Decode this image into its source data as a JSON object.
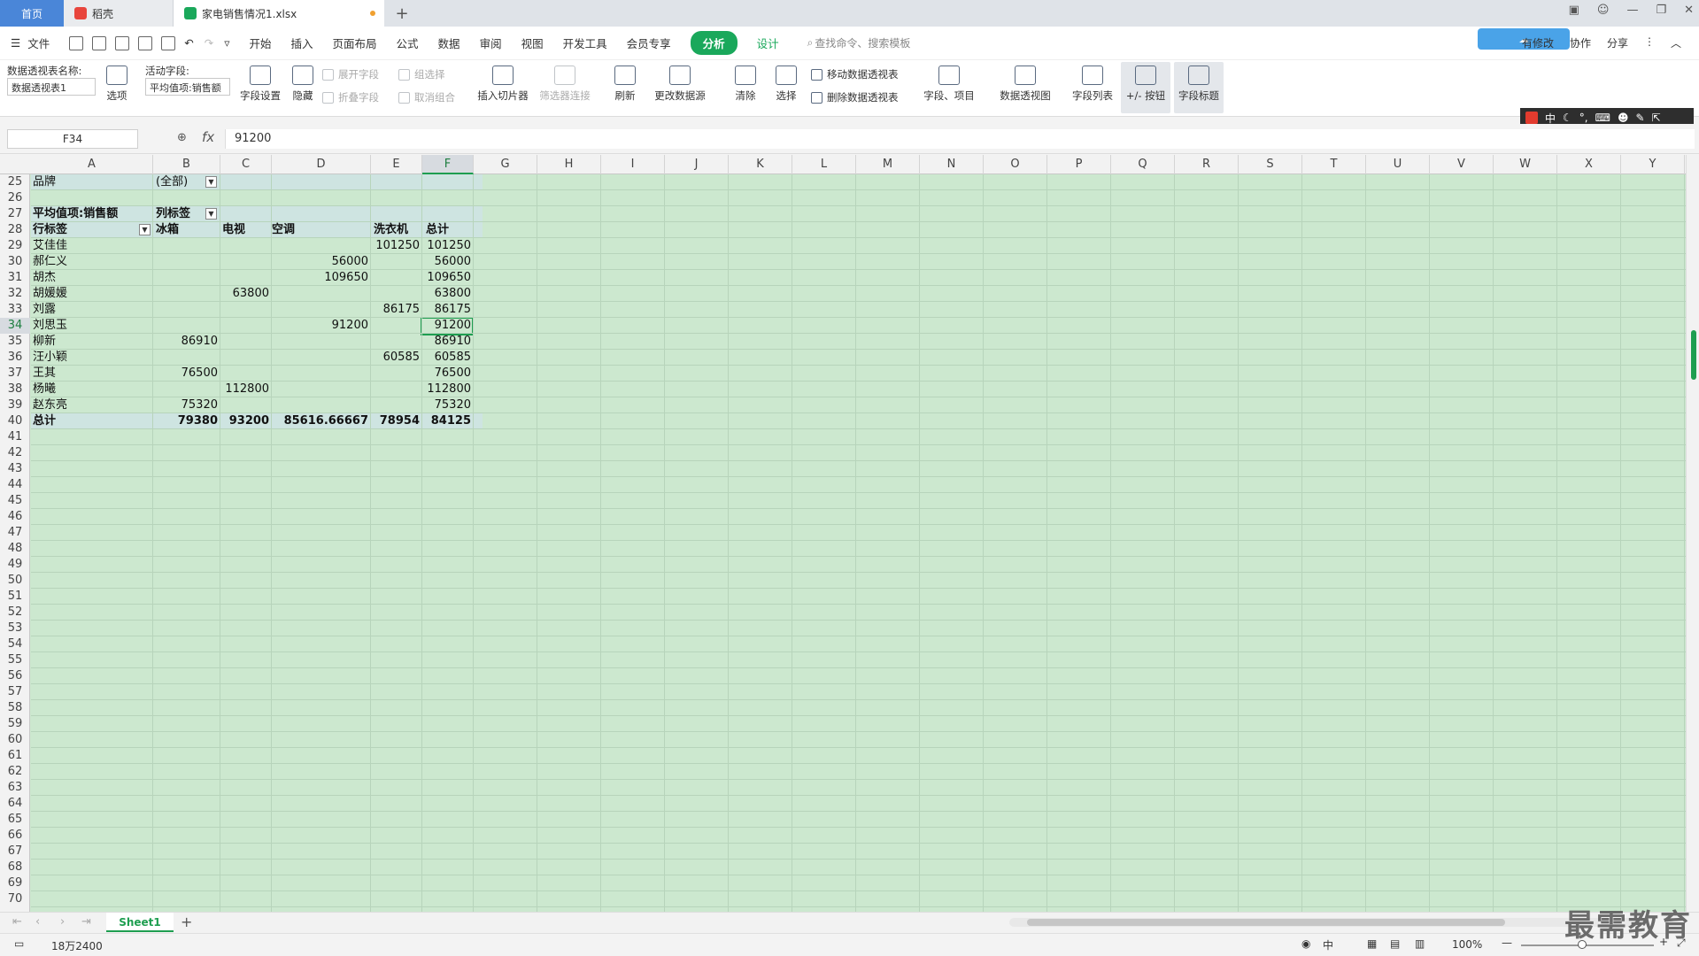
{
  "titlebar": {
    "home_tab": "首页",
    "doc_tab": "稻壳",
    "active_tab": "家电销售情况1.xlsx",
    "new_tab": "+"
  },
  "menubar": {
    "file": "文件",
    "items": [
      "开始",
      "插入",
      "页面布局",
      "公式",
      "数据",
      "审阅",
      "视图",
      "开发工具",
      "会员专享"
    ],
    "analyze": "分析",
    "design": "设计",
    "search": "查找命令、搜索模板",
    "right": [
      "有修改",
      "协作",
      "分享"
    ]
  },
  "ribbon": {
    "pivot_name_label": "数据透视表名称:",
    "pivot_name": "数据透视表1",
    "options": "选项",
    "active_field_label": "活动字段:",
    "active_field": "平均值项:销售额",
    "field_settings": "字段设置",
    "hide": "隐藏",
    "expand_field": "展开字段",
    "collapse_field": "折叠字段",
    "group_selection": "组选择",
    "ungroup": "取消组合",
    "insert_slicer": "插入切片器",
    "filter_connections": "筛选器连接",
    "refresh": "刷新",
    "change_source": "更改数据源",
    "clear": "清除",
    "select": "选择",
    "move_pivot": "移动数据透视表",
    "delete_pivot": "删除数据透视表",
    "fields_items": "字段、项目",
    "pivot_chart": "数据透视图",
    "field_list": "字段列表",
    "plus_minus": "+/- 按钮",
    "field_headers": "字段标题"
  },
  "ime": {
    "mode": "中"
  },
  "formulabar": {
    "cell_ref": "F34",
    "fx": "fx",
    "value": "91200"
  },
  "columns": [
    "A",
    "B",
    "C",
    "D",
    "E",
    "F",
    "G",
    "H",
    "I",
    "J",
    "K",
    "L",
    "M",
    "N",
    "O",
    "P",
    "Q",
    "R",
    "S",
    "T",
    "U",
    "V",
    "W",
    "X",
    "Y"
  ],
  "rows": [
    "25",
    "26",
    "27",
    "28",
    "29",
    "30",
    "31",
    "32",
    "33",
    "34",
    "35",
    "36",
    "37",
    "38",
    "39",
    "40",
    "41",
    "42",
    "43",
    "44",
    "45",
    "46",
    "47",
    "48",
    "49",
    "50",
    "51",
    "52",
    "53",
    "54",
    "55",
    "56",
    "57",
    "58",
    "59",
    "60",
    "61",
    "62",
    "63",
    "64",
    "65",
    "66",
    "67",
    "68",
    "69",
    "70"
  ],
  "pivot": {
    "filter_label": "品牌",
    "filter_value": "(全部)",
    "value_label": "平均值项:销售额",
    "col_label": "列标签",
    "row_label": "行标签",
    "headers": [
      "冰箱",
      "电视",
      "空调",
      "洗衣机",
      "总计"
    ],
    "rows": [
      {
        "name": "艾佳佳",
        "values": [
          "",
          "",
          "",
          "101250",
          "101250"
        ]
      },
      {
        "name": "郝仁义",
        "values": [
          "",
          "",
          "56000",
          "",
          "56000"
        ]
      },
      {
        "name": "胡杰",
        "values": [
          "",
          "",
          "109650",
          "",
          "109650"
        ]
      },
      {
        "name": "胡媛媛",
        "values": [
          "",
          "63800",
          "",
          "",
          "63800"
        ]
      },
      {
        "name": "刘露",
        "values": [
          "",
          "",
          "",
          "86175",
          "86175"
        ]
      },
      {
        "name": "刘思玉",
        "values": [
          "",
          "",
          "91200",
          "",
          "91200"
        ]
      },
      {
        "name": "柳新",
        "values": [
          "86910",
          "",
          "",
          "",
          "86910"
        ]
      },
      {
        "name": "汪小颖",
        "values": [
          "",
          "",
          "",
          "60585",
          "60585"
        ]
      },
      {
        "name": "王其",
        "values": [
          "76500",
          "",
          "",
          "",
          "76500"
        ]
      },
      {
        "name": "杨曦",
        "values": [
          "",
          "112800",
          "",
          "",
          "112800"
        ]
      },
      {
        "name": "赵东亮",
        "values": [
          "75320",
          "",
          "",
          "",
          "75320"
        ]
      }
    ],
    "total": {
      "name": "总计",
      "values": [
        "79380",
        "93200",
        "85616.66667",
        "78954",
        "84125"
      ]
    }
  },
  "sheets": [
    "Sheet1"
  ],
  "status": {
    "left": "18万2400",
    "zoom": "100%"
  },
  "watermark": "最需教育"
}
